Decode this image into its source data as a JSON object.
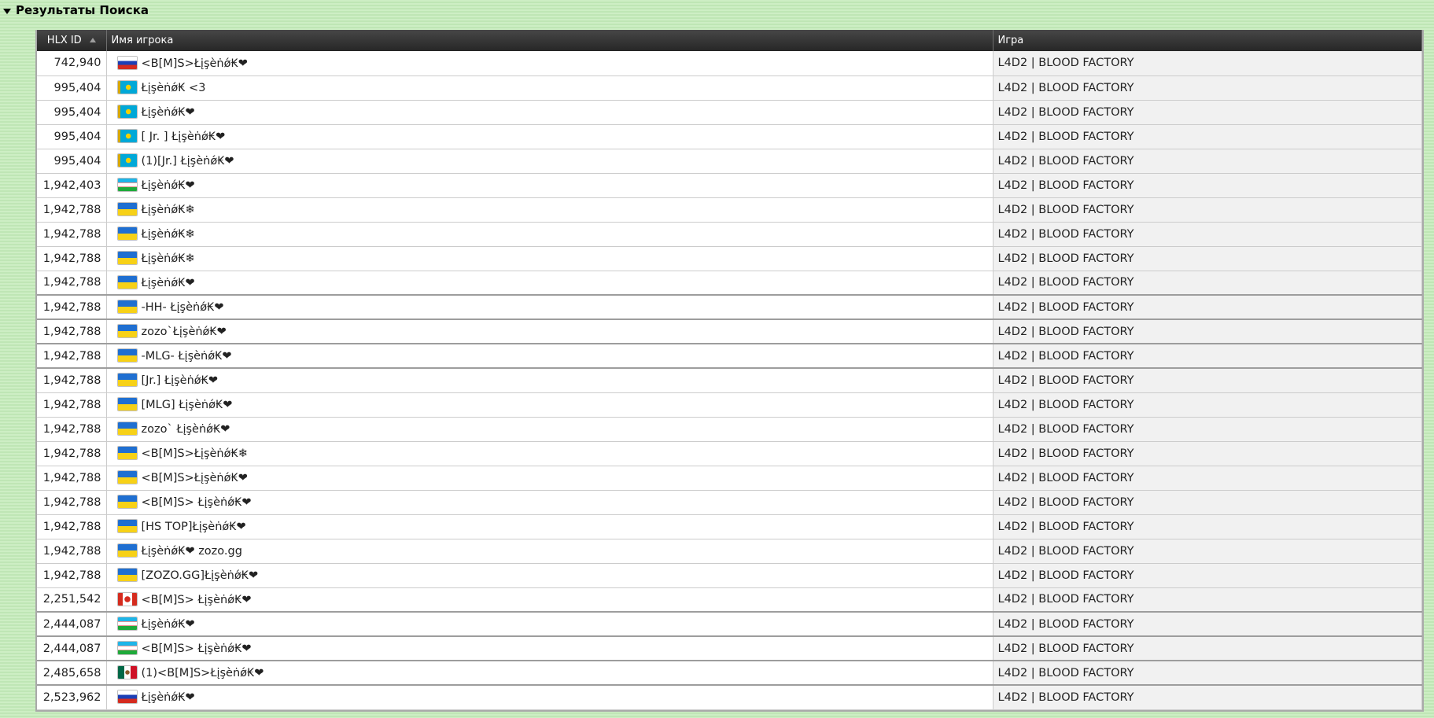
{
  "section": {
    "title": "Результаты Поиска"
  },
  "table": {
    "columns": {
      "id": "HLX ID",
      "name": "Имя игрока",
      "game": "Игра"
    },
    "rows": [
      {
        "id": "742,940",
        "flag": "ru",
        "name": "<B[M]S>Łįşèṅǿ₭❤",
        "game": "L4D2 | BLOOD FACTORY",
        "group_end": false
      },
      {
        "id": "995,404",
        "flag": "kz",
        "name": "Łįşèṅǿ₭ <3",
        "game": "L4D2 | BLOOD FACTORY",
        "group_end": false
      },
      {
        "id": "995,404",
        "flag": "kz",
        "name": "Łįşèṅǿ₭❤",
        "game": "L4D2 | BLOOD FACTORY",
        "group_end": false
      },
      {
        "id": "995,404",
        "flag": "kz",
        "name": "[ Jr. ] Łįşèṅǿ₭❤",
        "game": "L4D2 | BLOOD FACTORY",
        "group_end": false
      },
      {
        "id": "995,404",
        "flag": "kz",
        "name": "(1)[Jr.] Łįşèṅǿ₭❤",
        "game": "L4D2 | BLOOD FACTORY",
        "group_end": false
      },
      {
        "id": "1,942,403",
        "flag": "uz",
        "name": "Łįşèṅǿ₭❤",
        "game": "L4D2 | BLOOD FACTORY",
        "group_end": false
      },
      {
        "id": "1,942,788",
        "flag": "ua",
        "name": "Łįşèṅǿ₭❄",
        "game": "L4D2 | BLOOD FACTORY",
        "group_end": false
      },
      {
        "id": "1,942,788",
        "flag": "ua",
        "name": "Łįşèṅǿ₭❄",
        "game": "L4D2 | BLOOD FACTORY",
        "group_end": false
      },
      {
        "id": "1,942,788",
        "flag": "ua",
        "name": "Łįşèṅǿ₭❄",
        "game": "L4D2 | BLOOD FACTORY",
        "group_end": false
      },
      {
        "id": "1,942,788",
        "flag": "ua",
        "name": "Łįşèṅǿ₭❤",
        "game": "L4D2 | BLOOD FACTORY",
        "group_end": true
      },
      {
        "id": "1,942,788",
        "flag": "ua",
        "name": "-HH- Łįşèṅǿ₭❤",
        "game": "L4D2 | BLOOD FACTORY",
        "group_end": true
      },
      {
        "id": "1,942,788",
        "flag": "ua",
        "name": "zozo`Łįşèṅǿ₭❤",
        "game": "L4D2 | BLOOD FACTORY",
        "group_end": true
      },
      {
        "id": "1,942,788",
        "flag": "ua",
        "name": "-MLG- Łįşèṅǿ₭❤",
        "game": "L4D2 | BLOOD FACTORY",
        "group_end": true
      },
      {
        "id": "1,942,788",
        "flag": "ua",
        "name": "[Jr.] Łįşèṅǿ₭❤",
        "game": "L4D2 | BLOOD FACTORY",
        "group_end": false
      },
      {
        "id": "1,942,788",
        "flag": "ua",
        "name": "[MLG] Łįşèṅǿ₭❤",
        "game": "L4D2 | BLOOD FACTORY",
        "group_end": false
      },
      {
        "id": "1,942,788",
        "flag": "ua",
        "name": "zozo` Łįşèṅǿ₭❤",
        "game": "L4D2 | BLOOD FACTORY",
        "group_end": false
      },
      {
        "id": "1,942,788",
        "flag": "ua",
        "name": "<B[M]S>Łįşèṅǿ₭❄",
        "game": "L4D2 | BLOOD FACTORY",
        "group_end": false
      },
      {
        "id": "1,942,788",
        "flag": "ua",
        "name": "<B[M]S>Łįşèṅǿ₭❤",
        "game": "L4D2 | BLOOD FACTORY",
        "group_end": false
      },
      {
        "id": "1,942,788",
        "flag": "ua",
        "name": "<B[M]S> Łįşèṅǿ₭❤",
        "game": "L4D2 | BLOOD FACTORY",
        "group_end": false
      },
      {
        "id": "1,942,788",
        "flag": "ua",
        "name": "[HS TOP]Łįşèṅǿ₭❤",
        "game": "L4D2 | BLOOD FACTORY",
        "group_end": false
      },
      {
        "id": "1,942,788",
        "flag": "ua",
        "name": "Łįşèṅǿ₭❤ zozo.gg",
        "game": "L4D2 | BLOOD FACTORY",
        "group_end": false
      },
      {
        "id": "1,942,788",
        "flag": "ua",
        "name": "[ZOZO.GG]Łįşèṅǿ₭❤",
        "game": "L4D2 | BLOOD FACTORY",
        "group_end": false
      },
      {
        "id": "2,251,542",
        "flag": "ca",
        "name": "<B[M]S> Łįşèṅǿ₭❤",
        "game": "L4D2 | BLOOD FACTORY",
        "group_end": true
      },
      {
        "id": "2,444,087",
        "flag": "uz",
        "name": "Łįşèṅǿ₭❤",
        "game": "L4D2 | BLOOD FACTORY",
        "group_end": true
      },
      {
        "id": "2,444,087",
        "flag": "uz",
        "name": "<B[M]S> Łįşèṅǿ₭❤",
        "game": "L4D2 | BLOOD FACTORY",
        "group_end": true
      },
      {
        "id": "2,485,658",
        "flag": "mx",
        "name": "(1)<B[M]S>Łįşèṅǿ₭❤",
        "game": "L4D2 | BLOOD FACTORY",
        "group_end": true
      },
      {
        "id": "2,523,962",
        "flag": "ru",
        "name": "Łįşèṅǿ₭❤",
        "game": "L4D2 | BLOOD FACTORY",
        "group_end": false
      }
    ]
  }
}
